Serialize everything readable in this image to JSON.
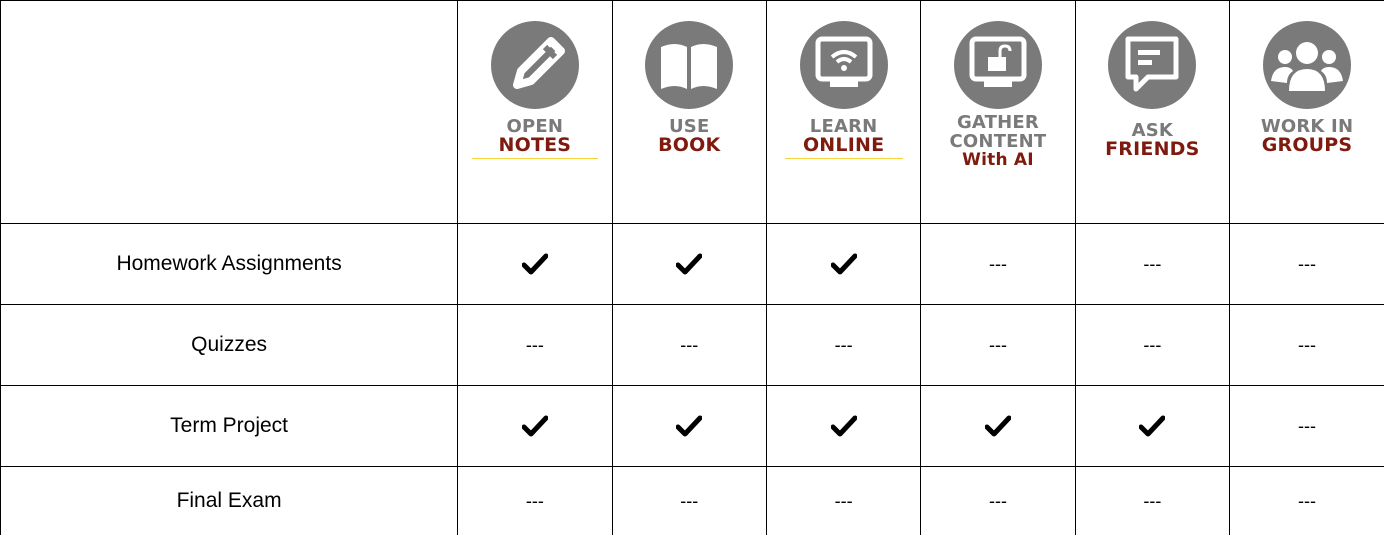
{
  "columns": [
    {
      "icon": "pencil-icon",
      "top": "OPEN",
      "bottom": "NOTES",
      "underline": true
    },
    {
      "icon": "book-icon",
      "top": "USE",
      "bottom": "BOOK",
      "underline": false
    },
    {
      "icon": "wifi-monitor-icon",
      "top": "LEARN",
      "bottom": "ONLINE",
      "underline": true
    },
    {
      "icon": "unlock-monitor-icon",
      "top1": "GATHER",
      "top2": "CONTENT",
      "bottom": "With AI",
      "underline": false
    },
    {
      "icon": "chat-bubble-icon",
      "top": "ASK",
      "bottom": "FRIENDS",
      "underline": false
    },
    {
      "icon": "group-icon",
      "top": "WORK IN",
      "bottom": "GROUPS",
      "underline": false
    }
  ],
  "rows": [
    {
      "label": "Homework Assignments",
      "cells": [
        "check",
        "check",
        "check",
        "---",
        "---",
        "---"
      ]
    },
    {
      "label": "Quizzes",
      "cells": [
        "---",
        "---",
        "---",
        "---",
        "---",
        "---"
      ]
    },
    {
      "label": "Term Project",
      "cells": [
        "check",
        "check",
        "check",
        "check",
        "check",
        "---"
      ]
    },
    {
      "label": "Final Exam",
      "cells": [
        "---",
        "---",
        "---",
        "---",
        "---",
        "---"
      ]
    }
  ],
  "colors": {
    "icon_gray": "#7a7a7a",
    "label_red": "#7f1a0e",
    "underline_yellow": "#f3d23a"
  }
}
